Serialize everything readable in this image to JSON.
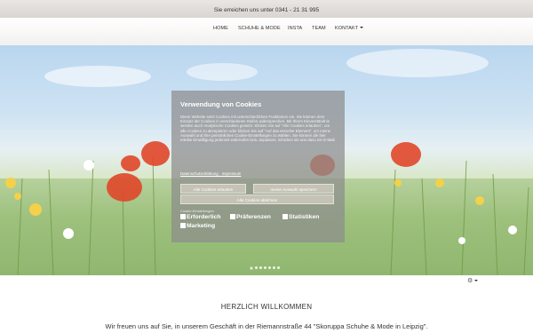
{
  "topbar": {
    "contact": "Sie erreichen uns unter 0341 - 21 31 995"
  },
  "nav": {
    "items": [
      "HOME",
      "SCHUHE & MODE",
      "INSTA",
      "TEAM",
      "KONTAKT"
    ]
  },
  "cookie_dialog": {
    "title": "Verwendung von Cookies",
    "body": "Diese Website setzt Cookies mit unterschiedlichen Funktionen ein. Sie können dem Einsatz der Cookies in verschiedenen Stufen widersprechen. Mit Ihrem Einverständnis werden auch Analytische Cookies gesetzt. Klicken Sie auf \"Alle Cookies erlauben\", um alle Cookies zu akzeptieren oder klicken Sie auf \"Auf das einzelne Element\", um meine Auswahl und Ihre persönlichen Cookie-Einstellungen zu wählen. Sie können die hier erteilte Einwilligung jederzeit widerrufen bzw. anpassen, schicken sie uns dazu ein E-Mail.",
    "privacy_link": "Datenschutzerklärung · Impressum",
    "btn_allow_all": "Alle Cookies erlauben",
    "btn_save": "meine Auswahl speichern",
    "btn_reject": "Alle Cookies ablehnen",
    "settings_label": "Cookie-Einstellungen",
    "categories": [
      "Erforderlich",
      "Präferenzen",
      "Statistiken",
      "Marketing"
    ]
  },
  "slider": {
    "dots": 7,
    "active": 0
  },
  "gear_icon": "gear-icon",
  "welcome": {
    "heading": "HERZLICH WILLKOMMEN",
    "text": "Wir freuen uns auf Sie, in unserem Geschäft in der Riemannstraße 44 \"Skoruppa Schuhe & Mode in Leipzig\"."
  },
  "colors": {
    "poppy": "#e0472a",
    "modal_bg": "#8c8c8c"
  }
}
